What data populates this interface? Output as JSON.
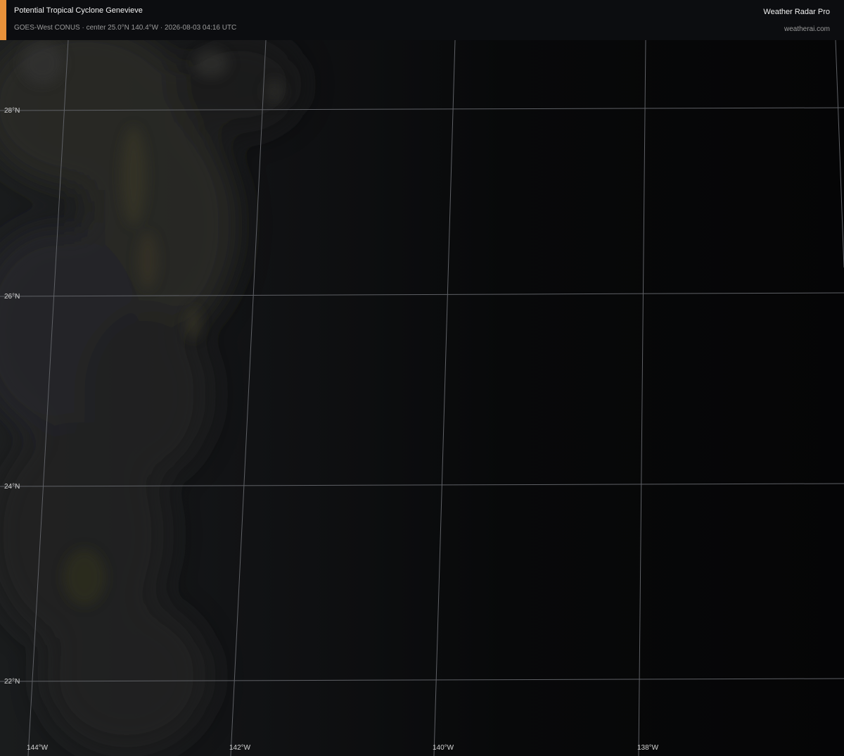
{
  "header": {
    "title": "Potential Tropical Cyclone Genevieve",
    "subtitle": "GOES-West CONUS · center 25.0°N 140.4°W · 2026-08-03 04:16 UTC",
    "brand": "Weather Radar Pro",
    "site": "weatherai.com",
    "accent_color": "#e8913a"
  },
  "map": {
    "gridline_color": "#5f6166",
    "latitudes": [
      {
        "value": 28,
        "label": "28°N"
      },
      {
        "value": 26,
        "label": "26°N"
      },
      {
        "value": 24,
        "label": "24°N"
      },
      {
        "value": 22,
        "label": "22°N"
      }
    ],
    "longitudes": [
      {
        "value": -144,
        "label": "144°W"
      },
      {
        "value": -142,
        "label": "142°W"
      },
      {
        "value": -140,
        "label": "140°W"
      },
      {
        "value": -138,
        "label": "138°W"
      }
    ]
  }
}
